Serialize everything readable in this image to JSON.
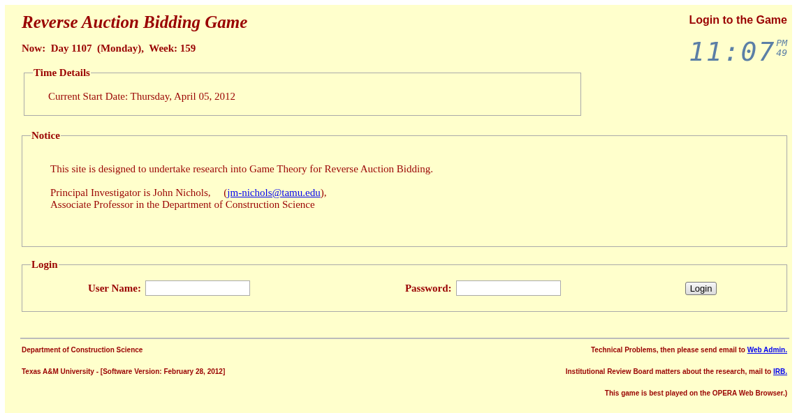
{
  "header": {
    "title": "Reverse Auction Bidding Game",
    "login_link": "Login to the Game",
    "now": "Now:  Day 1107  (Monday),  Week: 159"
  },
  "clock": {
    "time": "11:07",
    "ampm": "PM",
    "seconds": "49"
  },
  "time_details": {
    "legend": "Time Details",
    "start_date": "Current Start Date: Thursday, April 05, 2012"
  },
  "notice": {
    "legend": "Notice",
    "intro": "This site is designed to undertake research into Game Theory for Reverse Auction Bidding.",
    "investigator_before": "Principal Investigator is John Nichols,     (",
    "email": "jm-nichols@tamu.edu",
    "investigator_after": "),",
    "investigator_line2": "Associate Professor in the Department of Construction Science"
  },
  "login": {
    "legend": "Login",
    "username_label": "User Name:",
    "password_label": "Password:",
    "button": "Login"
  },
  "footer": {
    "left": [
      "Department of Construction Science",
      "Texas A&M University - [Software Version: February 28, 2012]"
    ],
    "right": [
      {
        "text": "Technical Problems, then please send email to",
        "link": "Web Admin."
      },
      {
        "text": "Institutional Review Board matters about the research, mail to",
        "link": "IRB."
      },
      {
        "text": "This game is best played on the OPERA Web Browser.)"
      }
    ]
  }
}
